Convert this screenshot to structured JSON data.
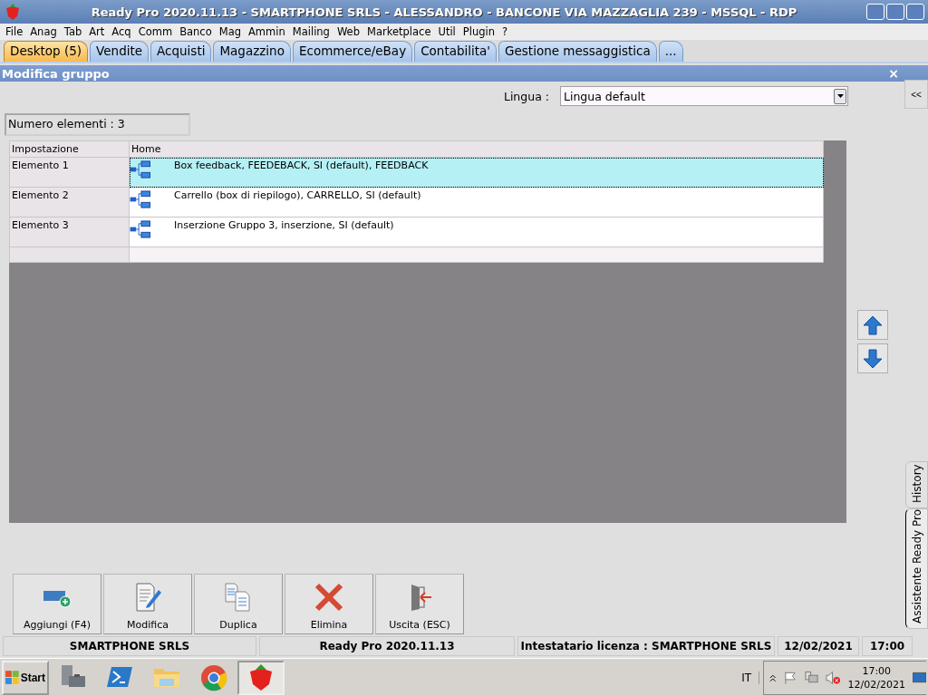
{
  "window": {
    "title": "Ready Pro 2020.11.13 - SMARTPHONE SRLS - ALESSANDRO - BANCONE VIA MAZZAGLIA 239 - MSSQL - RDP"
  },
  "menu": [
    "File",
    "Anag",
    "Tab",
    "Art",
    "Acq",
    "Comm",
    "Banco",
    "Mag",
    "Ammin",
    "Mailing",
    "Web",
    "Marketplace",
    "Util",
    "Plugin",
    "?"
  ],
  "tabs": [
    {
      "label": "Desktop (5)",
      "selected": true
    },
    {
      "label": "Vendite",
      "selected": false
    },
    {
      "label": "Acquisti",
      "selected": false
    },
    {
      "label": "Magazzino",
      "selected": false
    },
    {
      "label": "Ecommerce/eBay",
      "selected": false
    },
    {
      "label": "Contabilita'",
      "selected": false
    },
    {
      "label": "Gestione messaggistica",
      "selected": false
    },
    {
      "label": "...",
      "selected": false
    }
  ],
  "panel": {
    "title": "Modifica gruppo",
    "close": "×"
  },
  "language": {
    "label": "Lingua :",
    "value": "Lingua default"
  },
  "count": "Numero elementi : 3",
  "table": {
    "columns": [
      "Impostazione",
      "Home"
    ],
    "rows": [
      {
        "name": "Elemento 1",
        "value": "Box feedback, FEEDEBACK, SI (default), FEEDBACK",
        "selected": true
      },
      {
        "name": "Elemento 2",
        "value": "Carrello (box di riepilogo), CARRELLO, SI (default)",
        "selected": false
      },
      {
        "name": "Elemento 3",
        "value": "Inserzione Gruppo 3, inserzione, SI (default)",
        "selected": false
      }
    ]
  },
  "actions": [
    {
      "kind": "add",
      "label": "Aggiungi (F4)"
    },
    {
      "kind": "edit",
      "label": "Modifica"
    },
    {
      "kind": "copy",
      "label": "Duplica"
    },
    {
      "kind": "delete",
      "label": "Elimina"
    },
    {
      "kind": "exit",
      "label": "Uscita (ESC)"
    }
  ],
  "side": {
    "collapse": "<<",
    "tabs": [
      "History",
      "Assistente Ready Pro"
    ]
  },
  "status_bar": [
    "SMARTPHONE SRLS",
    "Ready Pro 2020.11.13",
    "Intestatario licenza : SMARTPHONE SRLS",
    "12/02/2021",
    "17:00"
  ],
  "taskbar": {
    "start": "Start",
    "apps": [
      {
        "kind": "server",
        "active": false
      },
      {
        "kind": "powershell",
        "active": false
      },
      {
        "kind": "explorer",
        "active": false
      },
      {
        "kind": "chrome",
        "active": false
      },
      {
        "kind": "strawberry",
        "active": true
      }
    ],
    "language": "IT",
    "time": "17:00",
    "date": "12/02/2021"
  }
}
